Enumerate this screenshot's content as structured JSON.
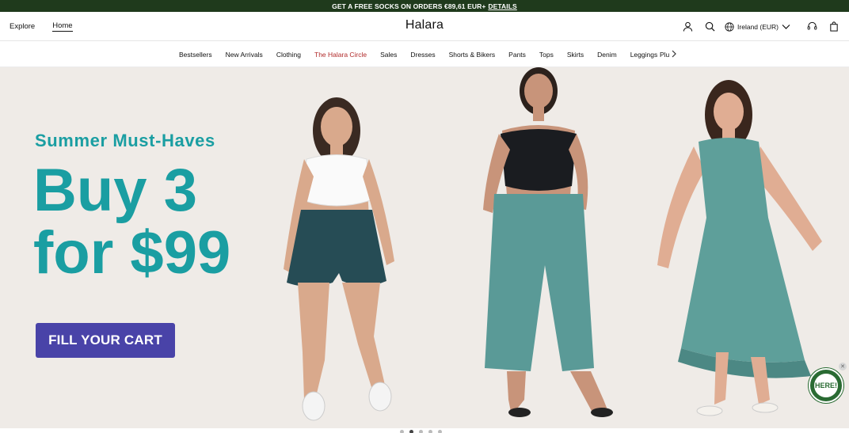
{
  "promo": {
    "text": "GET A FREE SOCKS ON ORDERS €89,61 EUR+",
    "link": "DETAILS"
  },
  "header": {
    "explore": "Explore",
    "home": "Home",
    "logo": "Halara",
    "region": "Ireland (EUR)"
  },
  "nav": {
    "items": [
      "Bestsellers",
      "New Arrivals",
      "Clothing",
      "The Halara Circle",
      "Sales",
      "Dresses",
      "Shorts & Bikers",
      "Pants",
      "Tops",
      "Skirts",
      "Denim",
      "Leggings"
    ],
    "clipped": "Plus",
    "highlight_index": 3
  },
  "hero": {
    "subtitle": "Summer Must-Haves",
    "title_line1": "Buy 3",
    "title_line2": "for $99",
    "cta": "FILL YOUR CART",
    "badge": "HERE!"
  },
  "carousel": {
    "dots": 5,
    "active": 1
  },
  "colors": {
    "accent": "#1a9ea2",
    "cta": "#4943a8",
    "promo_bg": "#1f3a1c",
    "hero_bg": "#efebe7"
  }
}
